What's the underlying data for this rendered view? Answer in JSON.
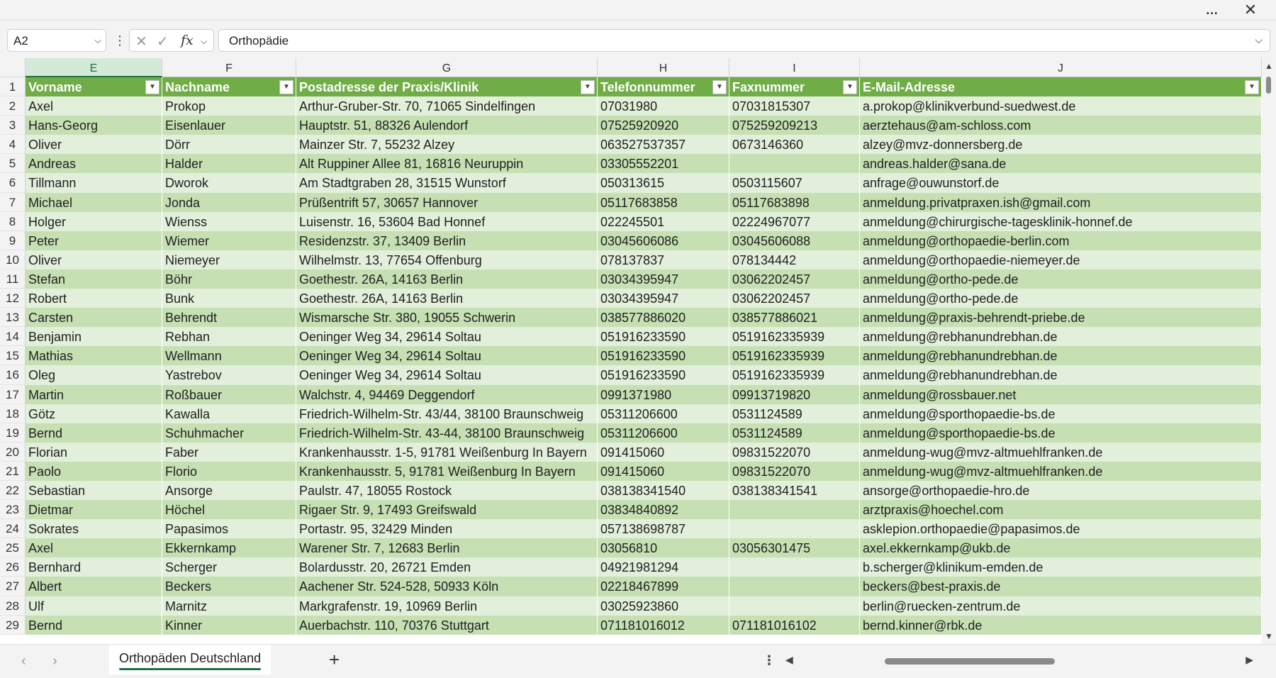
{
  "window": {
    "more_icon": "…",
    "close_icon": "✕"
  },
  "formula_bar": {
    "name_box": "A2",
    "formula_value": "Orthopädie",
    "fx_label": "fx"
  },
  "columns": [
    "E",
    "F",
    "G",
    "H",
    "I",
    "J"
  ],
  "selected_column": "E",
  "headers": [
    "Vorname",
    "Nachname",
    "Postadresse der Praxis/Klinik",
    "Telefonnummer",
    "Faxnummer",
    "E-Mail-Adresse"
  ],
  "rows": [
    {
      "n": "2",
      "c": [
        "Axel",
        "Prokop",
        "Arthur-Gruber-Str. 70, 71065 Sindelfingen",
        "07031980",
        "07031815307",
        "a.prokop@klinikverbund-suedwest.de"
      ]
    },
    {
      "n": "3",
      "c": [
        "Hans-Georg",
        "Eisenlauer",
        "Hauptstr. 51, 88326 Aulendorf",
        "07525920920",
        "075259209213",
        "aerztehaus@am-schloss.com"
      ]
    },
    {
      "n": "4",
      "c": [
        "Oliver",
        "Dörr",
        "Mainzer Str. 7, 55232 Alzey",
        "063527537357",
        "0673146360",
        "alzey@mvz-donnersberg.de"
      ]
    },
    {
      "n": "5",
      "c": [
        "Andreas",
        "Halder",
        "Alt Ruppiner Allee 81, 16816 Neuruppin",
        "03305552201",
        "",
        "andreas.halder@sana.de"
      ]
    },
    {
      "n": "6",
      "c": [
        "Tillmann",
        "Dworok",
        "Am Stadtgraben 28, 31515 Wunstorf",
        "050313615",
        "0503115607",
        "anfrage@ouwunstorf.de"
      ]
    },
    {
      "n": "7",
      "c": [
        "Michael",
        "Jonda",
        "Prüßentrift 57, 30657 Hannover",
        "05117683858",
        "05117683898",
        "anmeldung.privatpraxen.ish@gmail.com"
      ]
    },
    {
      "n": "8",
      "c": [
        "Holger",
        "Wienss",
        "Luisenstr. 16, 53604 Bad Honnef",
        "022245501",
        "02224967077",
        "anmeldung@chirurgische-tagesklinik-honnef.de"
      ]
    },
    {
      "n": "9",
      "c": [
        "Peter",
        "Wiemer",
        "Residenzstr. 37, 13409 Berlin",
        "03045606086",
        "03045606088",
        "anmeldung@orthopaedie-berlin.com"
      ]
    },
    {
      "n": "10",
      "c": [
        "Oliver",
        "Niemeyer",
        "Wilhelmstr. 13, 77654 Offenburg",
        "078137837",
        "078134442",
        "anmeldung@orthopaedie-niemeyer.de"
      ]
    },
    {
      "n": "11",
      "c": [
        "Stefan",
        "Böhr",
        "Goethestr. 26A, 14163 Berlin",
        "03034395947",
        "03062202457",
        "anmeldung@ortho-pede.de"
      ]
    },
    {
      "n": "12",
      "c": [
        "Robert",
        "Bunk",
        "Goethestr. 26A, 14163 Berlin",
        "03034395947",
        "03062202457",
        "anmeldung@ortho-pede.de"
      ]
    },
    {
      "n": "13",
      "c": [
        "Carsten",
        "Behrendt",
        "Wismarsche Str. 380, 19055 Schwerin",
        "038577886020",
        "038577886021",
        "anmeldung@praxis-behrendt-priebe.de"
      ]
    },
    {
      "n": "14",
      "c": [
        "Benjamin",
        "Rebhan",
        "Oeninger Weg 34, 29614 Soltau",
        "051916233590",
        "0519162335939",
        "anmeldung@rebhanundrebhan.de"
      ]
    },
    {
      "n": "15",
      "c": [
        "Mathias",
        "Wellmann",
        "Oeninger Weg 34, 29614 Soltau",
        "051916233590",
        "0519162335939",
        "anmeldung@rebhanundrebhan.de"
      ]
    },
    {
      "n": "16",
      "c": [
        "Oleg",
        "Yastrebov",
        "Oeninger Weg 34, 29614 Soltau",
        "051916233590",
        "0519162335939",
        "anmeldung@rebhanundrebhan.de"
      ]
    },
    {
      "n": "17",
      "c": [
        "Martin",
        "Roßbauer",
        "Walchstr. 4, 94469 Deggendorf",
        "0991371980",
        "09913719820",
        "anmeldung@rossbauer.net"
      ]
    },
    {
      "n": "18",
      "c": [
        "Götz",
        "Kawalla",
        "Friedrich-Wilhelm-Str. 43/44, 38100 Braunschweig",
        "05311206600",
        "0531124589",
        "anmeldung@sporthopaedie-bs.de"
      ]
    },
    {
      "n": "19",
      "c": [
        "Bernd",
        "Schuhmacher",
        "Friedrich-Wilhelm-Str. 43-44, 38100 Braunschweig",
        "05311206600",
        "0531124589",
        "anmeldung@sporthopaedie-bs.de"
      ]
    },
    {
      "n": "20",
      "c": [
        "Florian",
        "Faber",
        "Krankenhausstr. 1-5, 91781 Weißenburg In Bayern",
        "091415060",
        "09831522070",
        "anmeldung-wug@mvz-altmuehlfranken.de"
      ]
    },
    {
      "n": "21",
      "c": [
        "Paolo",
        "Florio",
        "Krankenhausstr. 5, 91781 Weißenburg In Bayern",
        "091415060",
        "09831522070",
        "anmeldung-wug@mvz-altmuehlfranken.de"
      ]
    },
    {
      "n": "22",
      "c": [
        "Sebastian",
        "Ansorge",
        "Paulstr. 47, 18055 Rostock",
        "038138341540",
        "038138341541",
        "ansorge@orthopaedie-hro.de"
      ]
    },
    {
      "n": "23",
      "c": [
        "Dietmar",
        "Höchel",
        "Rigaer Str. 9, 17493 Greifswald",
        "03834840892",
        "",
        "arztpraxis@hoechel.com"
      ]
    },
    {
      "n": "24",
      "c": [
        "Sokrates",
        "Papasimos",
        "Portastr. 95, 32429 Minden",
        "057138698787",
        "",
        "asklepion.orthopaedie@papasimos.de"
      ]
    },
    {
      "n": "25",
      "c": [
        "Axel",
        "Ekkernkamp",
        "Warener Str. 7, 12683 Berlin",
        "03056810",
        "03056301475",
        "axel.ekkernkamp@ukb.de"
      ]
    },
    {
      "n": "26",
      "c": [
        "Bernhard",
        "Scherger",
        "Bolardusstr. 20, 26721 Emden",
        "04921981294",
        "",
        "b.scherger@klinikum-emden.de"
      ]
    },
    {
      "n": "27",
      "c": [
        "Albert",
        "Beckers",
        "Aachener Str. 524-528, 50933 Köln",
        "02218467899",
        "",
        "beckers@best-praxis.de"
      ]
    },
    {
      "n": "28",
      "c": [
        "Ulf",
        "Marnitz",
        "Markgrafenstr. 19, 10969 Berlin",
        "03025923860",
        "",
        "berlin@ruecken-zentrum.de"
      ]
    },
    {
      "n": "29",
      "c": [
        "Bernd",
        "Kinner",
        "Auerbachstr. 110, 70376 Stuttgart",
        "071181016012",
        "071181016102",
        "bernd.kinner@rbk.de"
      ]
    }
  ],
  "sheet_tabs": [
    "Orthopäden Deutschland"
  ],
  "add_sheet_label": "+"
}
